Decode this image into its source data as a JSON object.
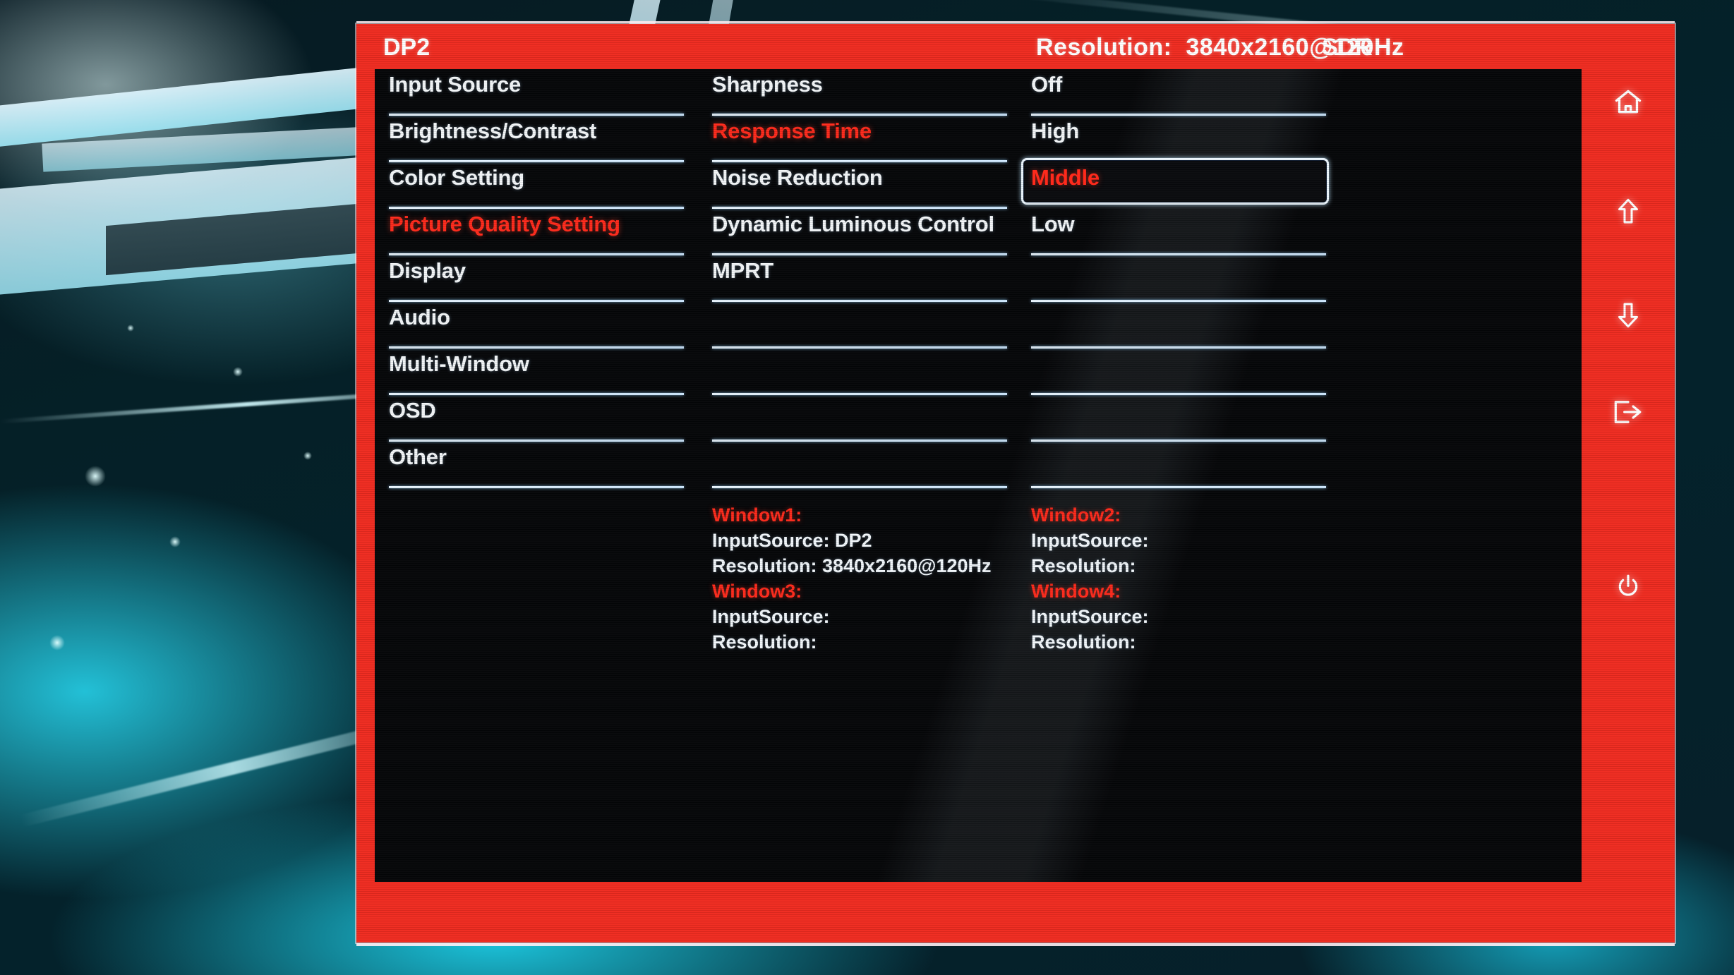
{
  "background": {
    "scene_description": "cyan sci-fi game scene"
  },
  "osd": {
    "header": {
      "input_label": "DP2",
      "resolution_label": "Resolution:",
      "resolution_value": "3840x2160@120Hz",
      "hdr_mode": "SDR"
    },
    "accent_color": "#f02b20",
    "selected_color": "#ff2a1c",
    "text_color": "#f3f6f8",
    "menu_column": {
      "items": [
        {
          "label": "Input Source",
          "selected": false
        },
        {
          "label": "Brightness/Contrast",
          "selected": false
        },
        {
          "label": "Color Setting",
          "selected": false
        },
        {
          "label": "Picture Quality Setting",
          "selected": true
        },
        {
          "label": "Display",
          "selected": false
        },
        {
          "label": "Audio",
          "selected": false
        },
        {
          "label": "Multi-Window",
          "selected": false
        },
        {
          "label": "OSD",
          "selected": false
        },
        {
          "label": "Other",
          "selected": false
        }
      ]
    },
    "submenu_column": {
      "items": [
        {
          "label": "Sharpness",
          "selected": false
        },
        {
          "label": "Response Time",
          "selected": true
        },
        {
          "label": "Noise Reduction",
          "selected": false
        },
        {
          "label": "Dynamic Luminous Control",
          "selected": false
        },
        {
          "label": "MPRT",
          "selected": false
        },
        {
          "label": "",
          "selected": false
        },
        {
          "label": "",
          "selected": false
        },
        {
          "label": "",
          "selected": false
        },
        {
          "label": "",
          "selected": false
        }
      ]
    },
    "option_column": {
      "items": [
        {
          "label": "Off",
          "selected": false,
          "boxed": false
        },
        {
          "label": "High",
          "selected": false,
          "boxed": false
        },
        {
          "label": "Middle",
          "selected": true,
          "boxed": true
        },
        {
          "label": "Low",
          "selected": false,
          "boxed": false
        },
        {
          "label": "",
          "selected": false,
          "boxed": false
        },
        {
          "label": "",
          "selected": false,
          "boxed": false
        },
        {
          "label": "",
          "selected": false,
          "boxed": false
        },
        {
          "label": "",
          "selected": false,
          "boxed": false
        },
        {
          "label": "",
          "selected": false,
          "boxed": false
        }
      ]
    },
    "window_info": {
      "left": [
        {
          "title": "Window1:",
          "input_source": "InputSource:   DP2",
          "resolution": "Resolution:  3840x2160@120Hz"
        },
        {
          "title": "Window3:",
          "input_source": "InputSource:",
          "resolution": "Resolution:"
        }
      ],
      "right": [
        {
          "title": "Window2:",
          "input_source": "InputSource:",
          "resolution": "Resolution:"
        },
        {
          "title": "Window4:",
          "input_source": "InputSource:",
          "resolution": "Resolution:"
        }
      ]
    },
    "rail": {
      "buttons": [
        {
          "icon": "home-icon",
          "name": "home"
        },
        {
          "icon": "arrow-up-icon",
          "name": "up"
        },
        {
          "icon": "arrow-down-icon",
          "name": "down"
        },
        {
          "icon": "exit-icon",
          "name": "exit"
        },
        {
          "icon": "power-icon",
          "name": "power"
        }
      ]
    }
  }
}
